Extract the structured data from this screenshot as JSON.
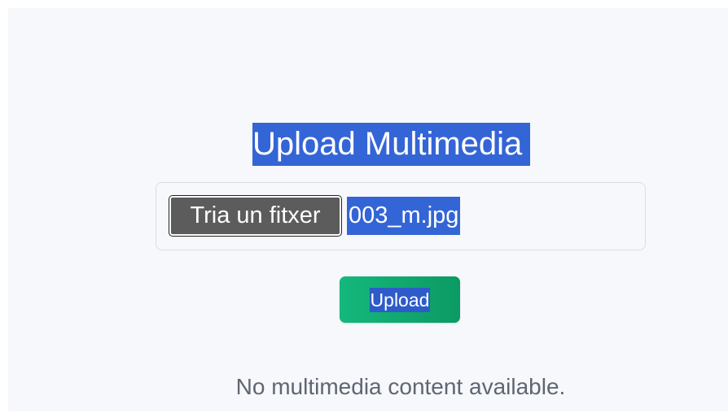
{
  "upload_form": {
    "title": "Upload Multimedia",
    "file_button_label": "Tria un fitxer",
    "selected_file": "003_m.jpg",
    "submit_label": "Upload"
  },
  "media_list": {
    "empty_message": "No multimedia content available."
  },
  "colors": {
    "selection_highlight": "#3465d6",
    "upload_button": "#14b87c",
    "page_background": "#f7f8fb",
    "muted_text": "#5f6673"
  }
}
